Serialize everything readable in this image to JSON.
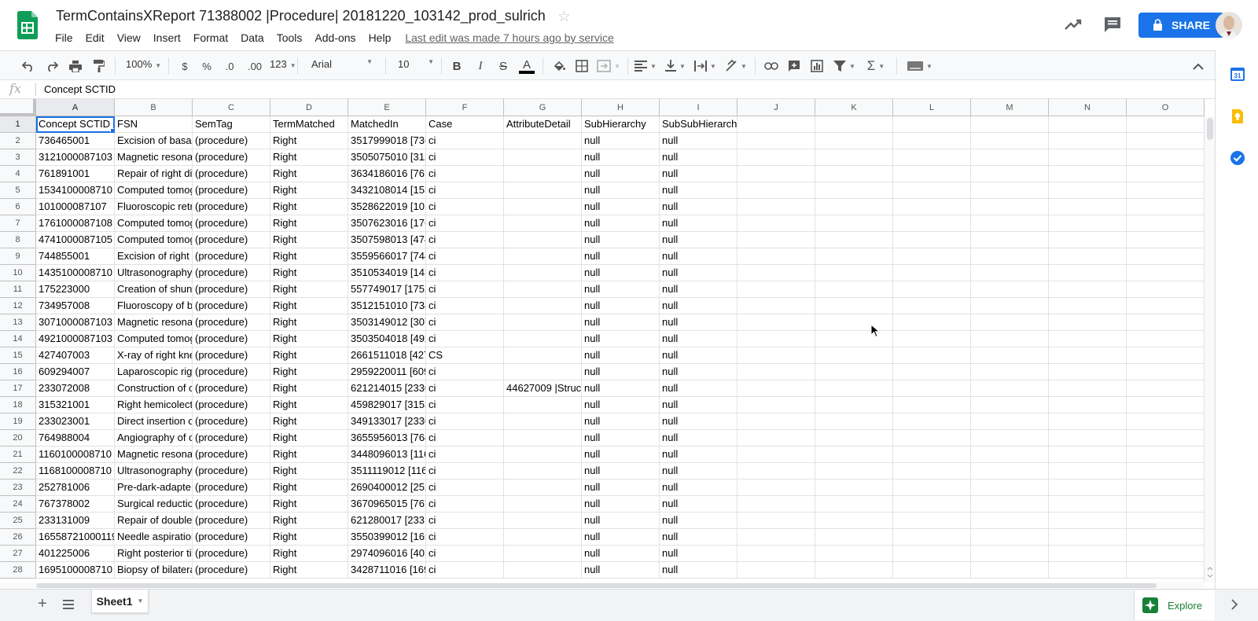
{
  "app": {
    "title": "TermContainsXReport 71388002 |Procedure| 20181220_103142_prod_sulrich",
    "last_edit": "Last edit was made 7 hours ago by service",
    "share_label": "SHARE",
    "colors": {
      "accent": "#1a73e8",
      "sheets_green": "#0f9d58",
      "explore_green": "#188038"
    }
  },
  "menu": [
    "File",
    "Edit",
    "View",
    "Insert",
    "Format",
    "Data",
    "Tools",
    "Add-ons",
    "Help"
  ],
  "toolbar": {
    "zoom": "100%",
    "currency": "$",
    "percent": "%",
    "decrease_decimal": ".0",
    "increase_decimal": ".00",
    "more_formats": "123",
    "font": "Arial",
    "font_size": "10",
    "bold": "B",
    "italic": "I",
    "strike": "S",
    "text_color": "A"
  },
  "formula_bar": {
    "fx": "fx",
    "content": "Concept SCTID"
  },
  "columns": [
    "A",
    "B",
    "C",
    "D",
    "E",
    "F",
    "G",
    "H",
    "I",
    "J",
    "K",
    "L",
    "M",
    "N",
    "O"
  ],
  "rows": [
    [
      "1",
      "Concept SCTID",
      "FSN",
      "SemTag",
      "TermMatched",
      "MatchedIn",
      "Case",
      "AttributeDetail",
      "SubHierarchy",
      "SubSubHierarchy",
      "",
      "",
      "",
      "",
      "",
      ""
    ],
    [
      "2",
      "736465001",
      "Excision of basal",
      "(procedure)",
      "Right",
      "3517999018 [736",
      "ci",
      "",
      "null",
      "null",
      "",
      "",
      "",
      "",
      "",
      ""
    ],
    [
      "3",
      "3121000087103",
      "Magnetic resona",
      "(procedure)",
      "Right",
      "3505075010 [312",
      "ci",
      "",
      "null",
      "null",
      "",
      "",
      "",
      "",
      "",
      ""
    ],
    [
      "4",
      "761891001",
      "Repair of right di",
      "(procedure)",
      "Right",
      "3634186016 [761",
      "ci",
      "",
      "null",
      "null",
      "",
      "",
      "",
      "",
      "",
      ""
    ],
    [
      "5",
      "1534100008710",
      "Computed tomog",
      "(procedure)",
      "Right",
      "3432108014 [153",
      "ci",
      "",
      "null",
      "null",
      "",
      "",
      "",
      "",
      "",
      ""
    ],
    [
      "6",
      "101000087107",
      "Fluoroscopic retr",
      "(procedure)",
      "Right",
      "3528622019 [101",
      "ci",
      "",
      "null",
      "null",
      "",
      "",
      "",
      "",
      "",
      ""
    ],
    [
      "7",
      "1761000087108",
      "Computed tomog",
      "(procedure)",
      "Right",
      "3507623016 [176",
      "ci",
      "",
      "null",
      "null",
      "",
      "",
      "",
      "",
      "",
      ""
    ],
    [
      "8",
      "4741000087105",
      "Computed tomog",
      "(procedure)",
      "Right",
      "3507598013 [474",
      "ci",
      "",
      "null",
      "null",
      "",
      "",
      "",
      "",
      "",
      ""
    ],
    [
      "9",
      "744855001",
      "Excision of right l",
      "(procedure)",
      "Right",
      "3559566017 [744",
      "ci",
      "",
      "null",
      "null",
      "",
      "",
      "",
      "",
      "",
      ""
    ],
    [
      "10",
      "1435100008710",
      "Ultrasonography",
      "(procedure)",
      "Right",
      "3510534019 [143",
      "ci",
      "",
      "null",
      "null",
      "",
      "",
      "",
      "",
      "",
      ""
    ],
    [
      "11",
      "175223000",
      "Creation of shun",
      "(procedure)",
      "Right",
      "557749017 [1752",
      "ci",
      "",
      "null",
      "null",
      "",
      "",
      "",
      "",
      "",
      ""
    ],
    [
      "12",
      "734957008",
      "Fluoroscopy of b",
      "(procedure)",
      "Right",
      "3512151010 [734",
      "ci",
      "",
      "null",
      "null",
      "",
      "",
      "",
      "",
      "",
      ""
    ],
    [
      "13",
      "3071000087103",
      "Magnetic resona",
      "(procedure)",
      "Right",
      "3503149012 [307",
      "ci",
      "",
      "null",
      "null",
      "",
      "",
      "",
      "",
      "",
      ""
    ],
    [
      "14",
      "4921000087103",
      "Computed tomog",
      "(procedure)",
      "Right",
      "3503504018 [492",
      "ci",
      "",
      "null",
      "null",
      "",
      "",
      "",
      "",
      "",
      ""
    ],
    [
      "15",
      "427407003",
      "X-ray of right kne",
      "(procedure)",
      "Right",
      "2661511018 [427",
      "CS",
      "",
      "null",
      "null",
      "",
      "",
      "",
      "",
      "",
      ""
    ],
    [
      "16",
      "609294007",
      "Laparoscopic rig",
      "(procedure)",
      "Right",
      "2959220011 [609",
      "ci",
      "",
      "null",
      "null",
      "",
      "",
      "",
      "",
      "",
      ""
    ],
    [
      "17",
      "233072008",
      "Construction of c",
      "(procedure)",
      "Right",
      "621214015 [2330",
      "ci",
      "44627009 |Struct",
      "null",
      "null",
      "",
      "",
      "",
      "",
      "",
      ""
    ],
    [
      "18",
      "315321001",
      "Right hemicolect",
      "(procedure)",
      "Right",
      "459829017 [3153",
      "ci",
      "",
      "null",
      "null",
      "",
      "",
      "",
      "",
      "",
      ""
    ],
    [
      "19",
      "233023001",
      "Direct insertion o",
      "(procedure)",
      "Right",
      "349133017 [2330",
      "ci",
      "",
      "null",
      "null",
      "",
      "",
      "",
      "",
      "",
      ""
    ],
    [
      "20",
      "764988004",
      "Angiography of c",
      "(procedure)",
      "Right",
      "3655956013 [764",
      "ci",
      "",
      "null",
      "null",
      "",
      "",
      "",
      "",
      "",
      ""
    ],
    [
      "21",
      "1160100008710",
      "Magnetic resona",
      "(procedure)",
      "Right",
      "3448096013 [116",
      "ci",
      "",
      "null",
      "null",
      "",
      "",
      "",
      "",
      "",
      ""
    ],
    [
      "22",
      "1168100008710",
      "Ultrasonography",
      "(procedure)",
      "Right",
      "3511119012 [116",
      "ci",
      "",
      "null",
      "null",
      "",
      "",
      "",
      "",
      "",
      ""
    ],
    [
      "23",
      "252781006",
      "Pre-dark-adapte",
      "(procedure)",
      "Right",
      "2690400012 [252",
      "ci",
      "",
      "null",
      "null",
      "",
      "",
      "",
      "",
      "",
      ""
    ],
    [
      "24",
      "767378002",
      "Surgical reductio",
      "(procedure)",
      "Right",
      "3670965015 [767",
      "ci",
      "",
      "null",
      "null",
      "",
      "",
      "",
      "",
      "",
      ""
    ],
    [
      "25",
      "233131009",
      "Repair of double",
      "(procedure)",
      "Right",
      "621280017 [2331",
      "ci",
      "",
      "null",
      "null",
      "",
      "",
      "",
      "",
      "",
      ""
    ],
    [
      "26",
      "16558721000119",
      "Needle aspiration",
      "(procedure)",
      "Right",
      "3550399012 [165",
      "ci",
      "",
      "null",
      "null",
      "",
      "",
      "",
      "",
      "",
      ""
    ],
    [
      "27",
      "401225006",
      "Right posterior til",
      "(procedure)",
      "Right",
      "2974096016 [401",
      "ci",
      "",
      "null",
      "null",
      "",
      "",
      "",
      "",
      "",
      ""
    ],
    [
      "28",
      "1695100008710",
      "Biopsy of bilatera",
      "(procedure)",
      "Right",
      "3428711016 [169",
      "ci",
      "",
      "null",
      "null",
      "",
      "",
      "",
      "",
      "",
      ""
    ]
  ],
  "sheets": [
    {
      "name": "Sheet1"
    }
  ],
  "explore_label": "Explore"
}
